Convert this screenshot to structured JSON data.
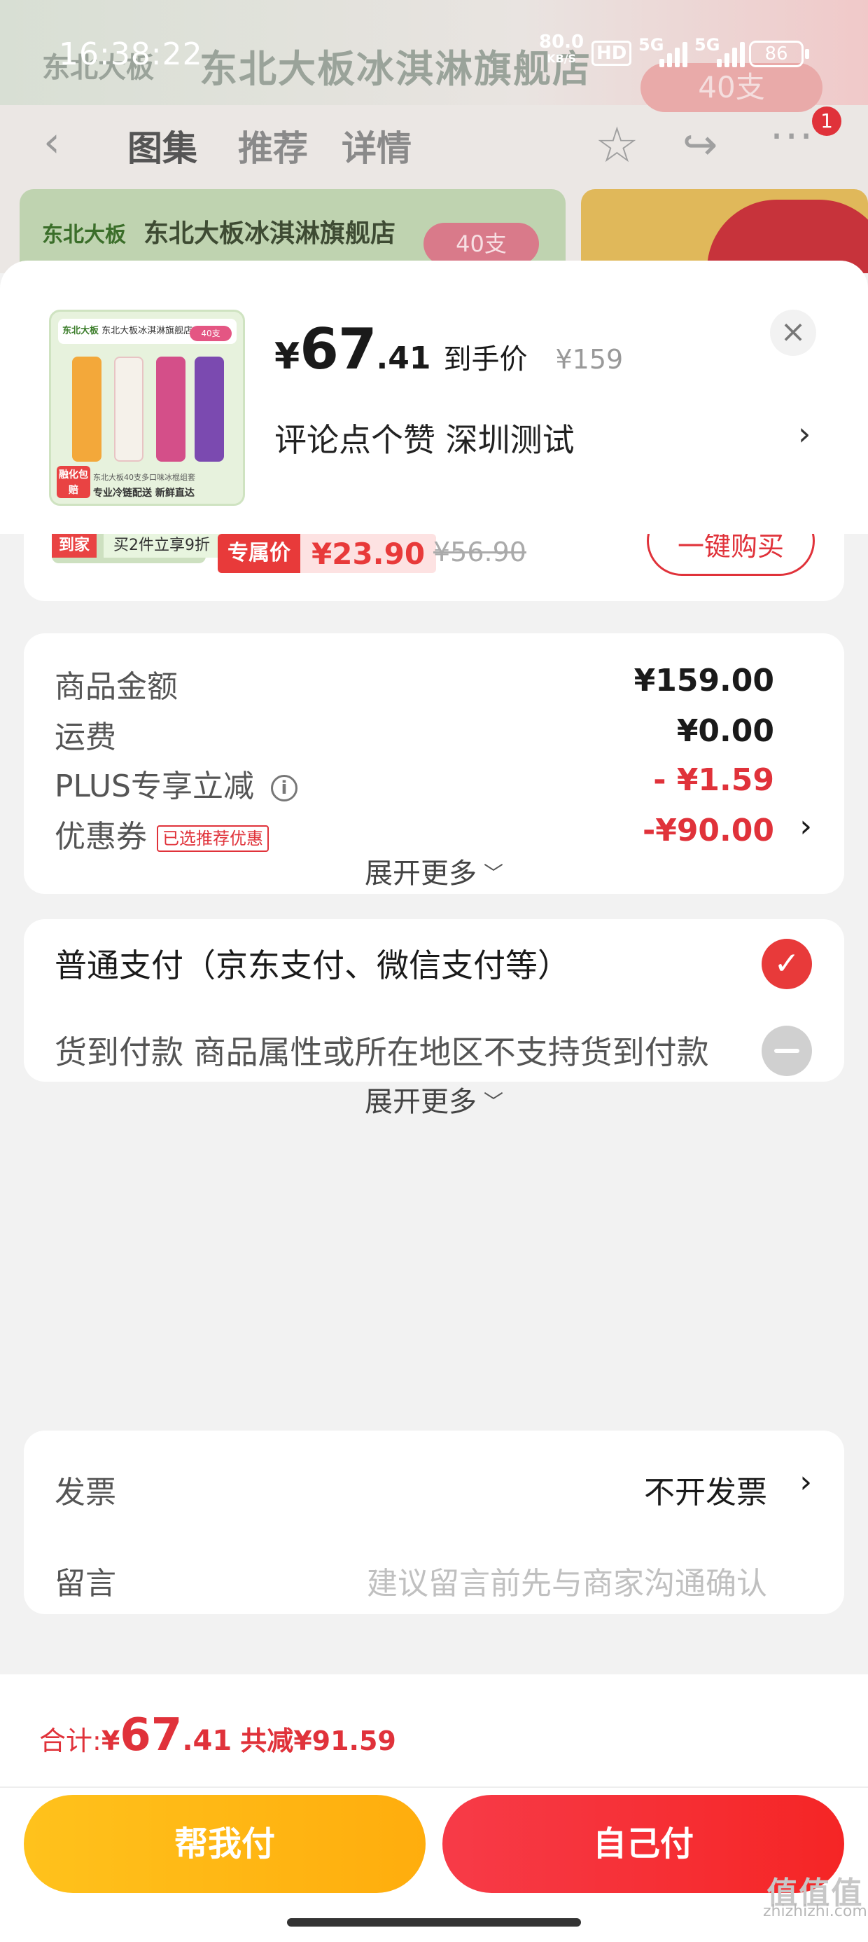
{
  "status_bar": {
    "time": "16:38:22",
    "net_speed": "80.0",
    "net_unit": "KB/S",
    "hd": "HD",
    "sig1": "5G",
    "sig2": "5G",
    "battery": "86"
  },
  "background": {
    "banner_text": "东北大板冰淇淋旗舰店",
    "banner_logo": "东北大板",
    "banner_badge": "40支",
    "tabs": [
      "图集",
      "推荐",
      "详情"
    ],
    "notification_count": "1",
    "card_title": "东北大板冰淇淋旗舰店",
    "card_logo": "东北大板",
    "card_badge": "40支"
  },
  "product": {
    "image_header_logo": "东北大板",
    "image_header": "东北大板冰淇淋旗舰店",
    "image_badge": "40支",
    "image_caption": "东北大板40支多口味冰棍组套",
    "image_footer": "专业冷链配送  新鲜直达",
    "image_tag": "融化包赔",
    "price_yen": "¥",
    "price_int": "67",
    "price_dec": ".41",
    "price_label": "到手价",
    "original_price": "¥159",
    "address": "评论点个赞  深圳测试",
    "close_icon": "×",
    "arrow": "›"
  },
  "item": {
    "tag1": "到家",
    "tag2": "买2件立享9折",
    "exclusive_tag": "专属价",
    "exclusive_price": "¥23.90",
    "strike_price": "¥56.90",
    "buy_label": "一键购买"
  },
  "costs": {
    "goods_label": "商品金额",
    "goods_value": "¥159.00",
    "shipping_label": "运费",
    "shipping_value": "¥0.00",
    "plus_label": "PLUS专享立减",
    "plus_value": "- ¥1.59",
    "coupon_label": "优惠券",
    "coupon_tag": "已选推荐优惠",
    "coupon_value": "-¥90.00",
    "expand_label": "展开更多"
  },
  "payment": {
    "normal_label": "普通支付（京东支付、微信支付等）",
    "cod_label": "货到付款 商品属性或所在地区不支持货到付款",
    "expand_label": "展开更多"
  },
  "extra": {
    "invoice_label": "发票",
    "invoice_value": "不开发票",
    "note_label": "留言",
    "note_placeholder": "建议留言前先与商家沟通确认"
  },
  "footer": {
    "total_label": "合计:",
    "total_yen": "¥",
    "total_int": "67",
    "total_dec": ".41",
    "total_save": "共减¥91.59",
    "friend_pay": "帮我付",
    "self_pay": "自己付",
    "watermark_big": "值值值",
    "watermark_small": "zhizhizhi.com"
  },
  "colors": {
    "accent_red": "#e0323a",
    "friend_button": "#ffb816",
    "self_button": "#f53240"
  }
}
